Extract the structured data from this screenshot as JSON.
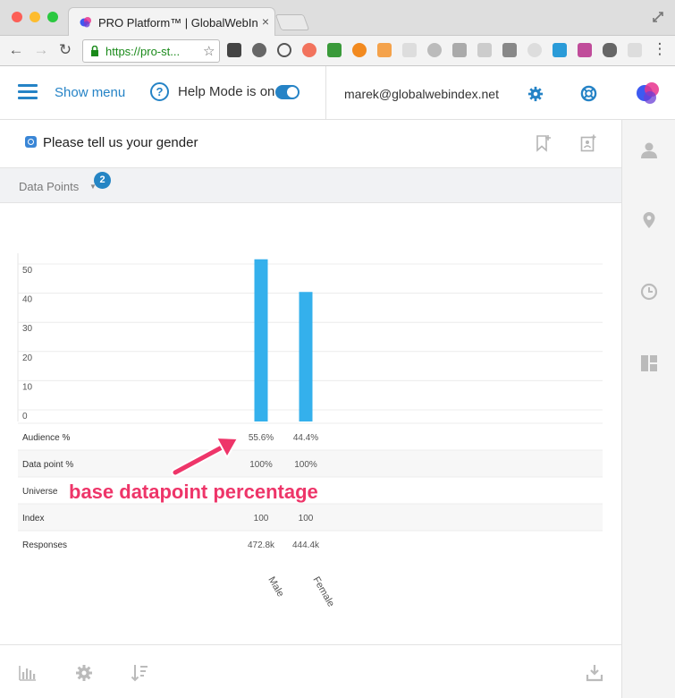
{
  "browser": {
    "tab_title": "PRO Platform™ | GlobalWebIndex",
    "url": "https://pro-st..."
  },
  "header": {
    "show_menu_label": "Show menu",
    "help_mode_label": "Help Mode is on",
    "help_mode_on": true,
    "user_email": "marek@globalwebindex.net"
  },
  "question": {
    "text": "Please tell us your gender"
  },
  "datapoints_bar": {
    "label": "Data Points",
    "count": "2"
  },
  "chart_data": {
    "type": "bar",
    "categories": [
      "Male",
      "Female"
    ],
    "values": [
      55.6,
      44.4
    ],
    "yticks": [
      "50",
      "40",
      "30",
      "20",
      "10",
      "0"
    ],
    "ylim": [
      0,
      55
    ],
    "bar_color": "#34b0ec",
    "table": {
      "rows": [
        {
          "label": "Audience %",
          "values": [
            "55.6%",
            "44.4%"
          ]
        },
        {
          "label": "Data point %",
          "values": [
            "100%",
            "100%"
          ]
        },
        {
          "label": "Universe",
          "values": [
            "",
            ""
          ]
        },
        {
          "label": "Index",
          "values": [
            "100",
            "100"
          ]
        },
        {
          "label": "Responses",
          "values": [
            "472.8k",
            "444.4k"
          ]
        }
      ]
    }
  },
  "annotation": {
    "text": "base datapoint percentage",
    "color": "#ee3569"
  },
  "icons": {
    "right_sidebar": [
      "person-icon",
      "location-pin-icon",
      "clock-icon",
      "dashboard-icon"
    ],
    "bottom_bar": [
      "bar-chart-icon",
      "gear-icon",
      "sort-icon",
      "download-icon"
    ]
  },
  "colors": {
    "accent": "#2583c6",
    "bar": "#34b0ec"
  }
}
